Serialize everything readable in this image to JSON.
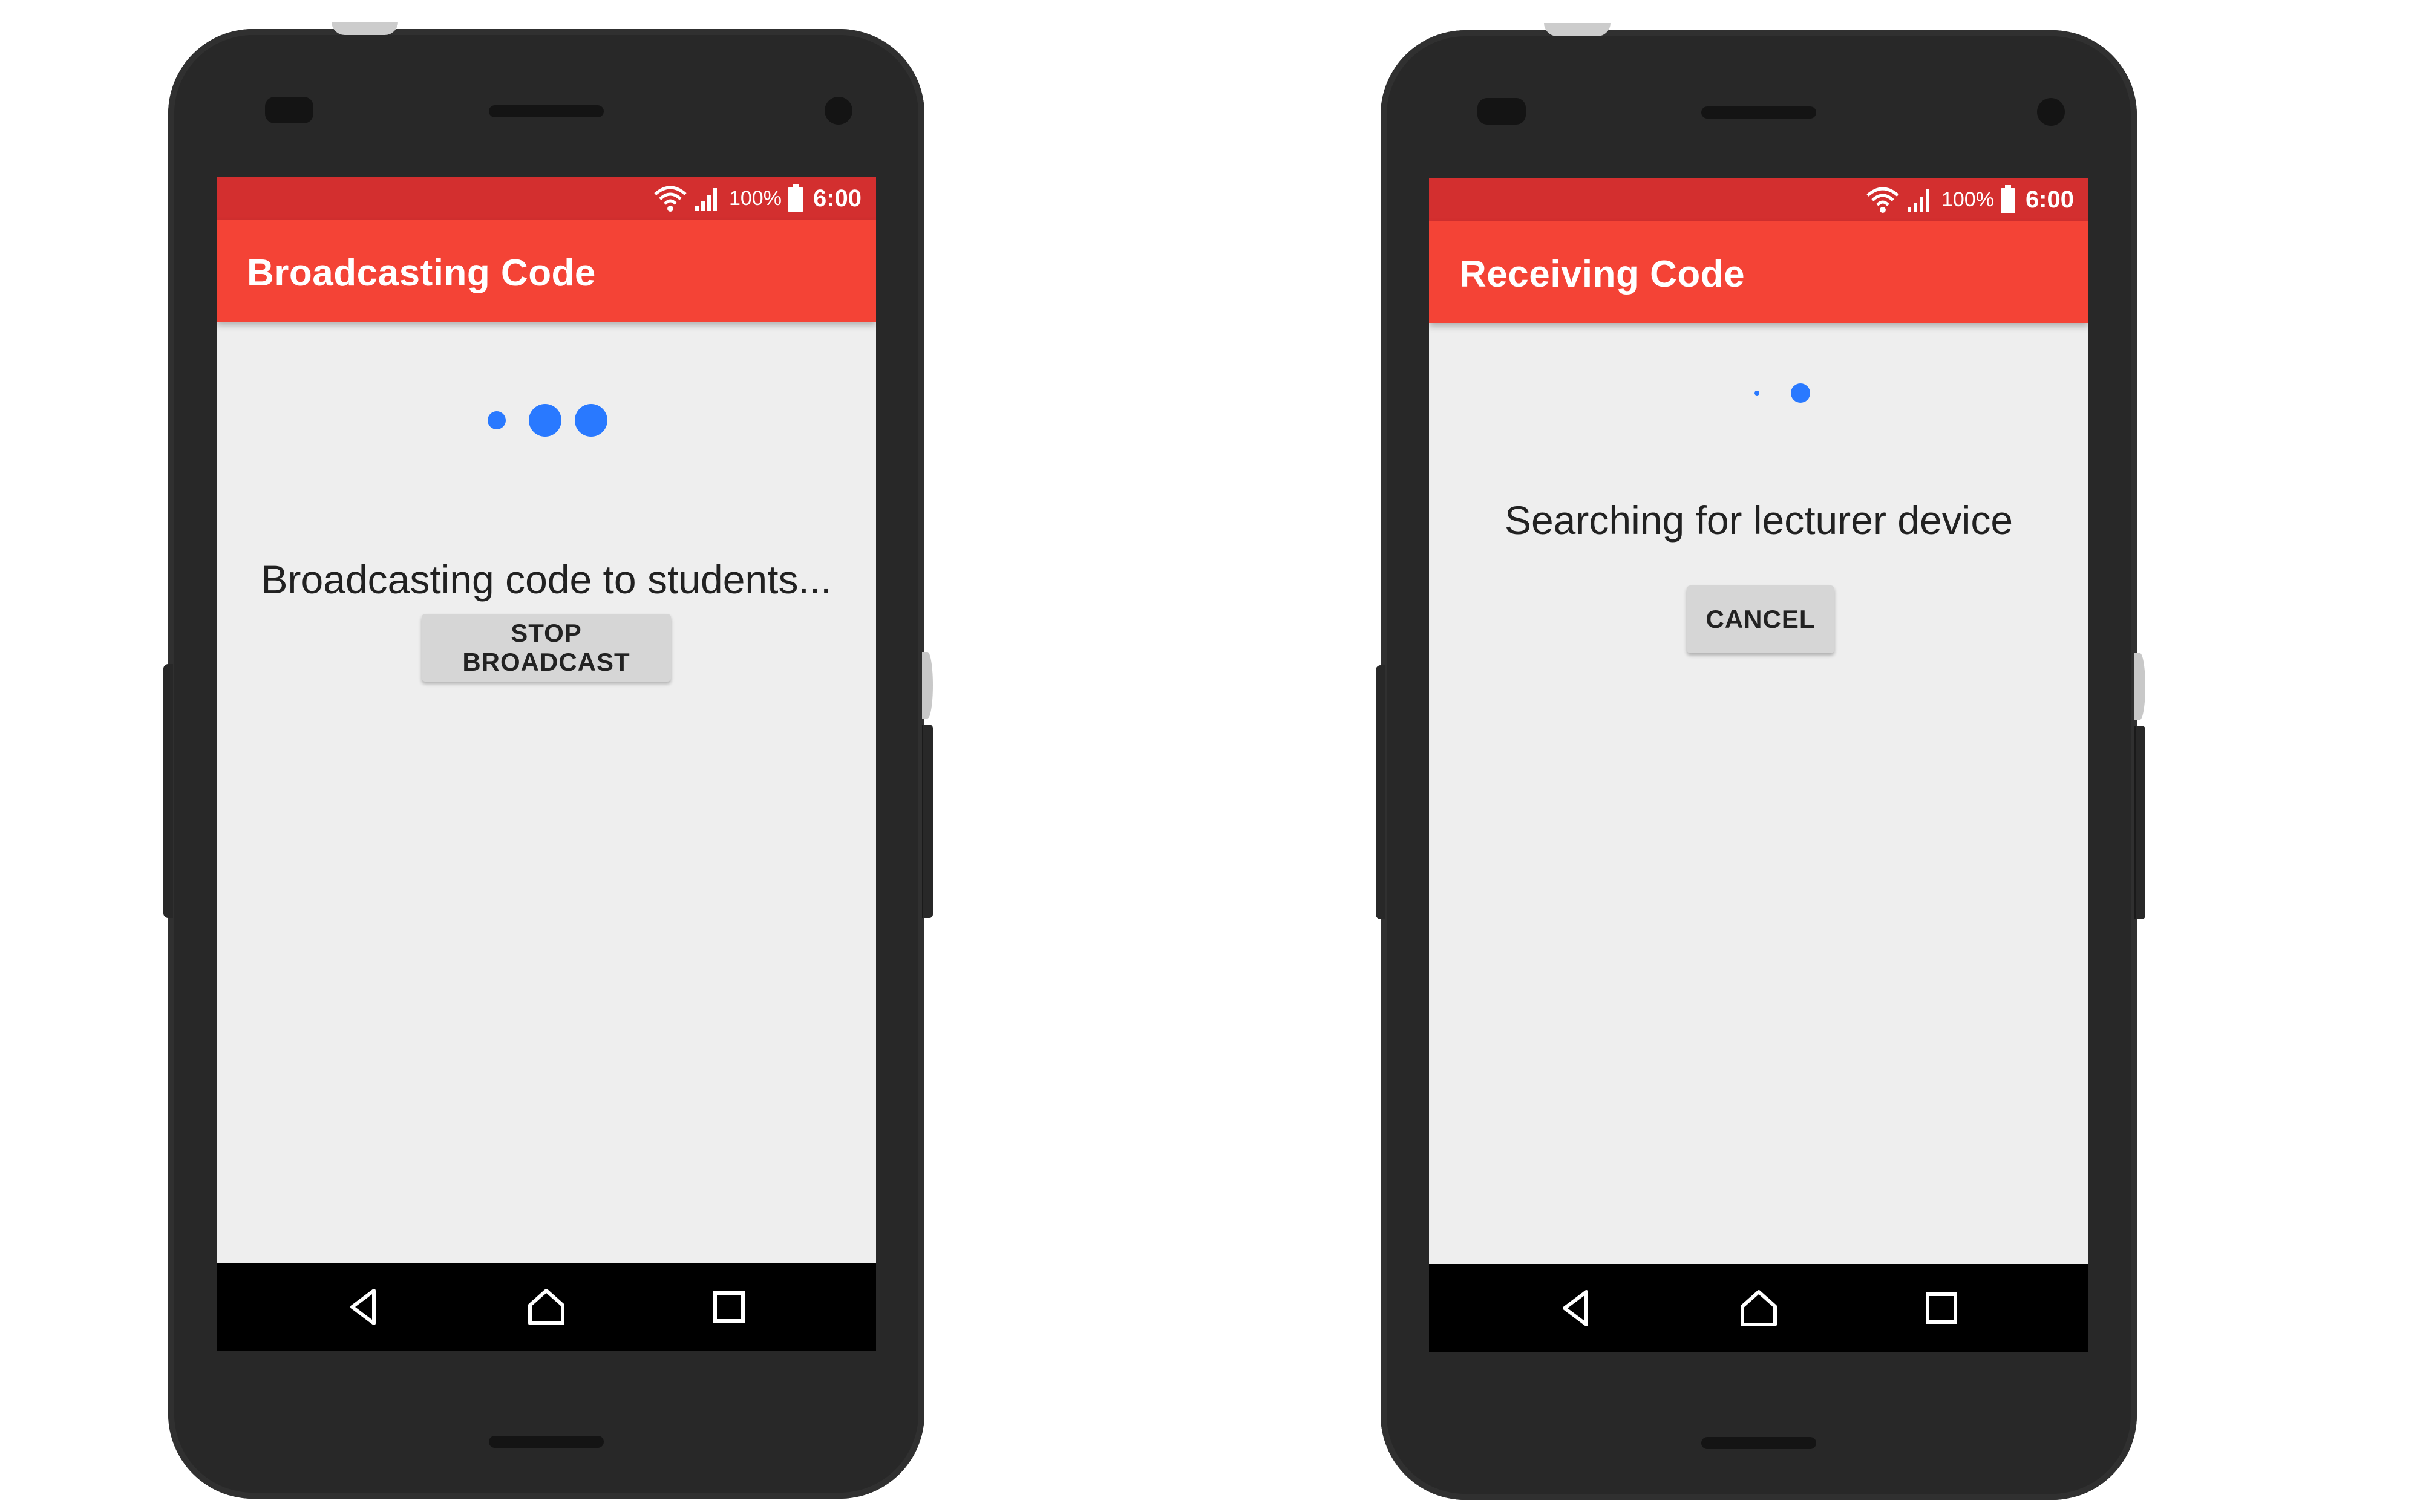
{
  "status_bar": {
    "battery_percent": "100%",
    "time": "6:00"
  },
  "screens": [
    {
      "title": "Broadcasting Code",
      "message": "Broadcasting code to students...",
      "button_label": "STOP BROADCAST"
    },
    {
      "title": "Receiving Code",
      "message": "Searching for lecturer device",
      "button_label": "CANCEL"
    }
  ],
  "colors": {
    "status_bar": "#d32f2f",
    "app_bar": "#f44336",
    "accent_dots": "#2979ff",
    "screen_background": "#eeeeee",
    "phone_body": "#282828"
  },
  "icons": {
    "status": [
      "wifi-icon",
      "signal-icon",
      "battery-icon"
    ],
    "navigation": [
      "back-icon",
      "home-icon",
      "recents-icon"
    ]
  }
}
